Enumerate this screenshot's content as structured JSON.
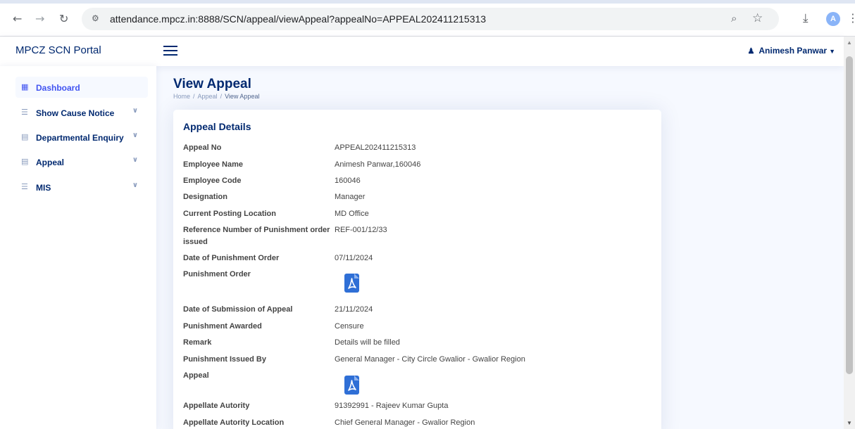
{
  "browser": {
    "url": "attendance.mpcz.in:8888/SCN/appeal/viewAppeal?appealNo=APPEAL202411215313",
    "avatar_letter": "A",
    "icons": [
      "back-icon",
      "forward-icon",
      "reload-icon",
      "site-info-icon",
      "zoom-icon",
      "bookmark-star-icon",
      "download-icon",
      "profile-avatar",
      "more-menu-icon"
    ]
  },
  "header": {
    "logo": "MPCZ SCN Portal",
    "user_name": "Animesh Panwar"
  },
  "sidebar": {
    "items": [
      {
        "label": "Dashboard",
        "icon": "grid-icon"
      },
      {
        "label": "Show Cause Notice",
        "icon": "menu-icon"
      },
      {
        "label": "Departmental Enquiry",
        "icon": "document-icon"
      },
      {
        "label": "Appeal",
        "icon": "document-icon"
      },
      {
        "label": "MIS",
        "icon": "menu-icon"
      }
    ]
  },
  "page": {
    "title": "View Appeal",
    "breadcrumb": [
      "Home",
      "Appeal",
      "View Appeal"
    ]
  },
  "card": {
    "title": "Appeal Details",
    "rows": [
      {
        "label": "Appeal No",
        "value": "APPEAL202411215313"
      },
      {
        "label": "Employee Name",
        "value": "Animesh Panwar,160046"
      },
      {
        "label": "Employee Code",
        "value": "160046"
      },
      {
        "label": "Designation",
        "value": "Manager"
      },
      {
        "label": "Current Posting Location",
        "value": "MD Office"
      },
      {
        "label": "Reference Number of Punishment order issued",
        "value": "REF-001/12/33"
      },
      {
        "label": "Date of Punishment Order",
        "value": "07/11/2024"
      },
      {
        "label": "Punishment Order",
        "value": ""
      },
      {
        "label": "Date of Submission of Appeal",
        "value": "21/11/2024"
      },
      {
        "label": "Punishment Awarded",
        "value": "Censure"
      },
      {
        "label": "Remark",
        "value": "Details will be filled"
      },
      {
        "label": "Punishment Issued By",
        "value": "General Manager - City Circle Gwalior - Gwalior Region"
      },
      {
        "label": "Appeal",
        "value": ""
      },
      {
        "label": "Appellate Autority",
        "value": "91392991 - Rajeev Kumar Gupta"
      },
      {
        "label": "Appellate Autority Location",
        "value": "Chief General Manager - Gwalior Region"
      }
    ]
  },
  "colors": {
    "brand": "#012970",
    "accent": "#4154f1",
    "pdf": "#2f6fd6",
    "page_bg": "#f6f9ff"
  }
}
